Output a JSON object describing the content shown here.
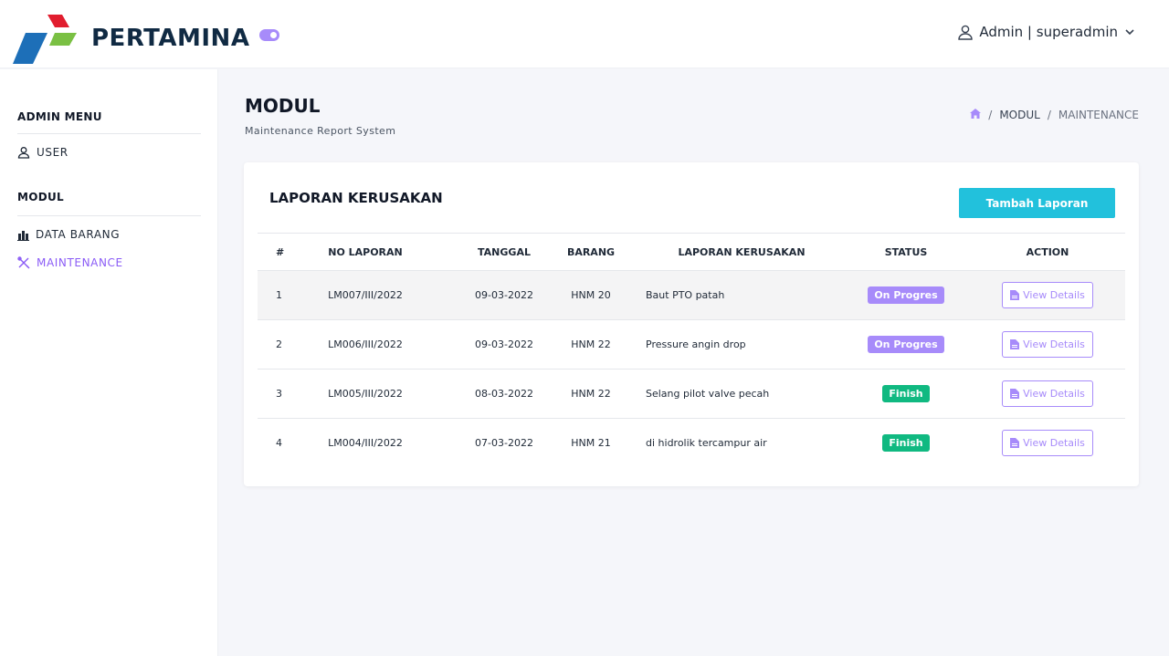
{
  "brand": {
    "name": "PERTAMINA"
  },
  "topbar": {
    "user_label": "Admin | superadmin"
  },
  "sidebar": {
    "admin_heading": "ADMIN MENU",
    "user_item": "USER",
    "modul_heading": "MODUL",
    "items": [
      {
        "label": "DATA BARANG",
        "icon": "building-icon"
      },
      {
        "label": "MAINTENANCE",
        "icon": "tools-icon",
        "active": true
      }
    ]
  },
  "page": {
    "title": "MODUL",
    "subtitle": "Maintenance Report System",
    "breadcrumb": [
      "MODUL",
      "MAINTENANCE"
    ]
  },
  "card": {
    "title": "LAPORAN KERUSAKAN",
    "add_button": "Tambah Laporan",
    "columns": [
      "#",
      "NO LAPORAN",
      "TANGGAL",
      "BARANG",
      "LAPORAN KERUSAKAN",
      "STATUS",
      "ACTION"
    ],
    "rows": [
      {
        "num": "1",
        "no": "LM007/III/2022",
        "tanggal": "09-03-2022",
        "barang": "HNM 20",
        "laporan": "Baut PTO patah",
        "status": "On Progres",
        "action": "View Details"
      },
      {
        "num": "2",
        "no": "LM006/III/2022",
        "tanggal": "09-03-2022",
        "barang": "HNM 22",
        "laporan": "Pressure angin drop",
        "status": "On Progres",
        "action": "View Details"
      },
      {
        "num": "3",
        "no": "LM005/III/2022",
        "tanggal": "08-03-2022",
        "barang": "HNM 22",
        "laporan": "Selang pilot valve pecah",
        "status": "Finish",
        "action": "View Details"
      },
      {
        "num": "4",
        "no": "LM004/III/2022",
        "tanggal": "07-03-2022",
        "barang": "HNM 21",
        "laporan": "di hidrolik tercampur air",
        "status": "Finish",
        "action": "View Details"
      }
    ]
  },
  "colors": {
    "accent": "#a78bfa",
    "primary_button": "#22c1dc",
    "finish": "#10b981"
  }
}
